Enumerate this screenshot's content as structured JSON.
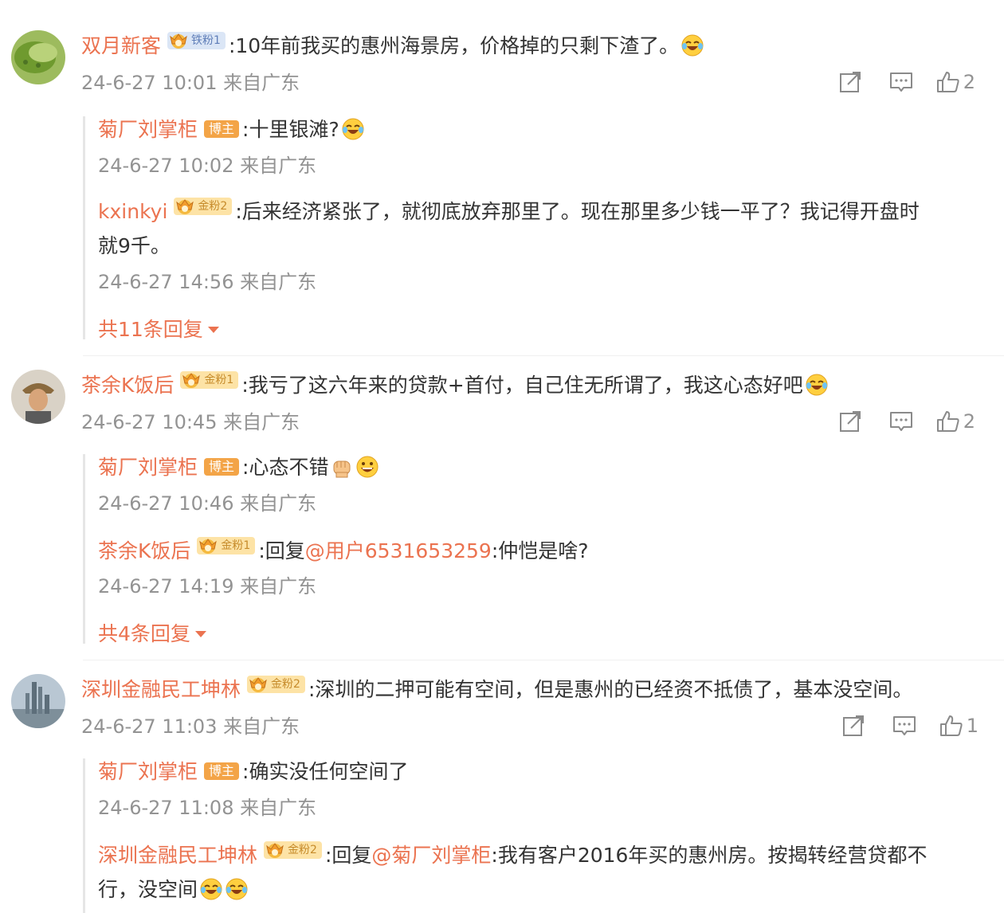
{
  "colors": {
    "name": "#eb7350",
    "text": "#333333",
    "meta": "#939393",
    "rail": "#e6e6e6"
  },
  "comments": [
    {
      "user": "双月新客",
      "badge": "铁粉1",
      "text": ":10年前我买的惠州海景房，价格掉的只剩下渣了。",
      "time": "24-6-27 10:01 来自广东",
      "likes": "2",
      "replies": [
        {
          "user": "菊厂刘掌柜",
          "badge": "博主",
          "text": ":十里银滩?",
          "time": "24-6-27 10:02 来自广东"
        },
        {
          "user": "kxinkyi",
          "badge": "金粉2",
          "text1": ":后来经济紧张了，就彻底放弃那里了。现在那里多少钱一平了？我记得开盘时",
          "text2": "就9千。",
          "time": "24-6-27 14:56 来自广东"
        }
      ],
      "more": "共11条回复"
    },
    {
      "user": "茶余K饭后",
      "badge": "金粉1",
      "text": ":我亏了这六年来的贷款+首付，自己住无所谓了，我这心态好吧",
      "time": "24-6-27 10:45 来自广东",
      "likes": "2",
      "replies": [
        {
          "user": "菊厂刘掌柜",
          "badge": "博主",
          "text": ":心态不错",
          "time": "24-6-27 10:46 来自广东"
        },
        {
          "user": "茶余K饭后",
          "badge": "金粉1",
          "prefix": ":回复",
          "mention": "@用户6531653259",
          "text": ":仲恺是啥?",
          "time": "24-6-27 14:19 来自广东"
        }
      ],
      "more": "共4条回复"
    },
    {
      "user": "深圳金融民工坤林",
      "badge": "金粉2",
      "text": ":深圳的二押可能有空间，但是惠州的已经资不抵债了，基本没空间。",
      "time": "24-6-27 11:03 来自广东",
      "likes": "1",
      "replies": [
        {
          "user": "菊厂刘掌柜",
          "badge": "博主",
          "text": ":确实没任何空间了",
          "time": "24-6-27 11:08 来自广东"
        },
        {
          "user": "深圳金融民工坤林",
          "badge": "金粉2",
          "prefix": ":回复",
          "mention": "@菊厂刘掌柜",
          "text1": ":我有客户2016年买的惠州房。按揭转经营贷都不",
          "text2": "行，没空间"
        }
      ]
    }
  ]
}
